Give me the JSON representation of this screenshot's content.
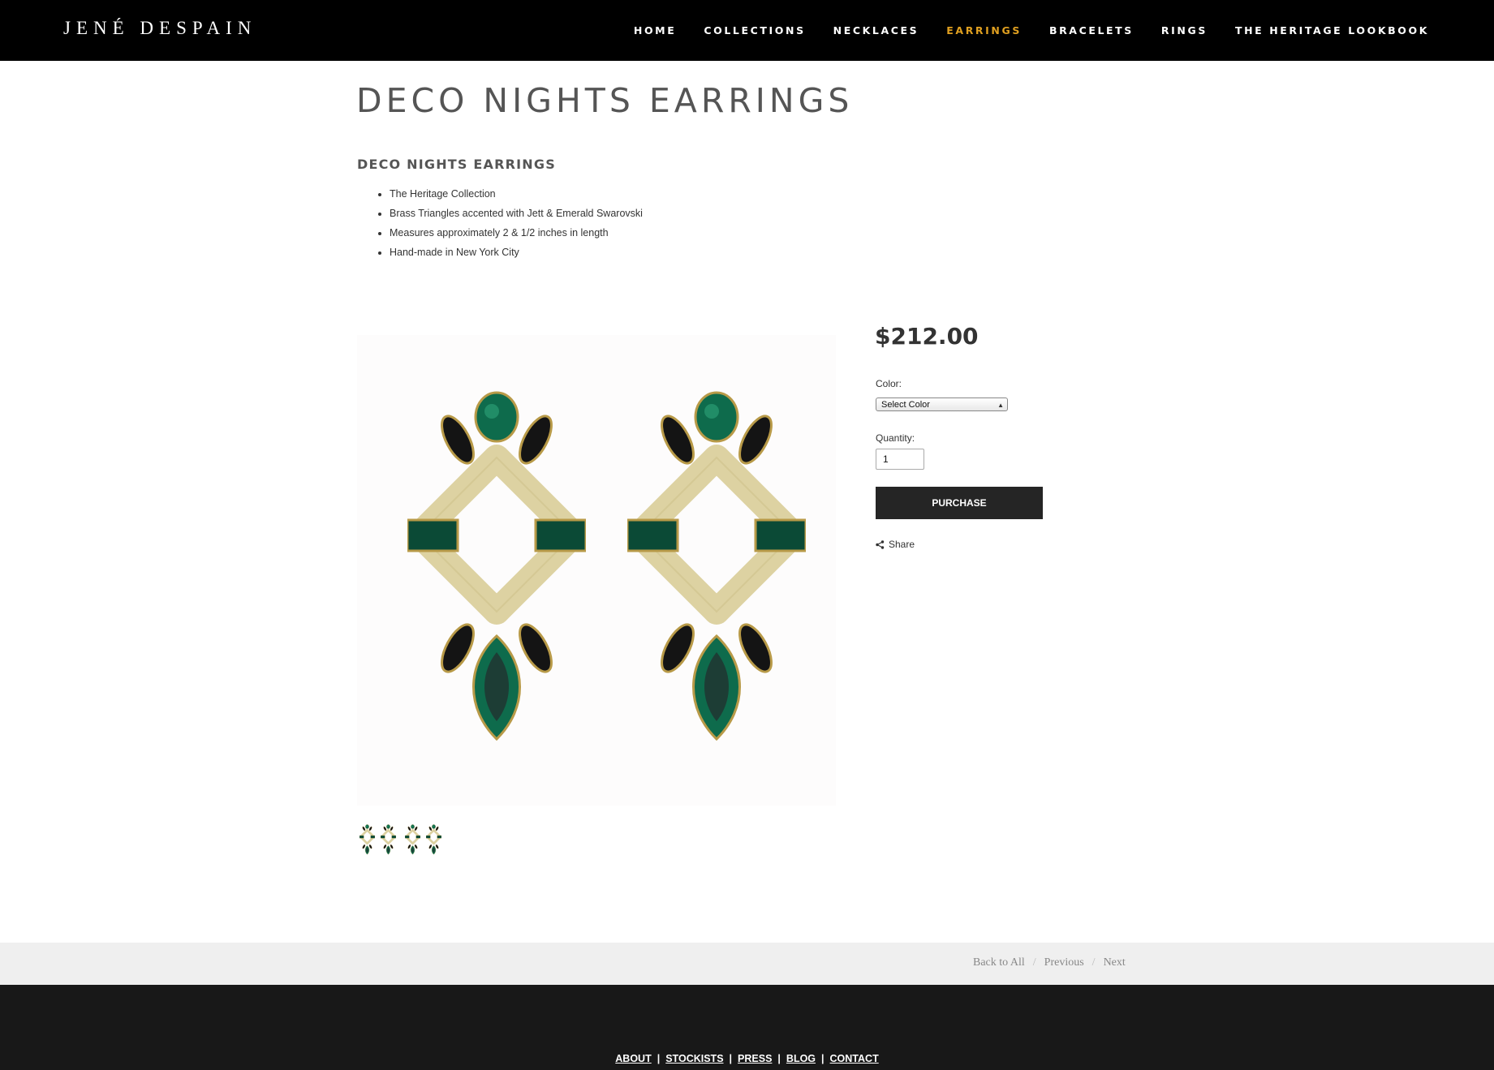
{
  "header": {
    "logo": "JENÉ DESPAIN",
    "nav": [
      "HOME",
      "COLLECTIONS",
      "NECKLACES",
      "EARRINGS",
      "BRACELETS",
      "RINGS",
      "THE HERITAGE LOOKBOOK"
    ],
    "active_item": "EARRINGS",
    "active_color": "#e0a020"
  },
  "product": {
    "page_title": "DECO NIGHTS EARRINGS",
    "subtitle": "DECO NIGHTS EARRINGS",
    "details": [
      "The Heritage Collection",
      "Brass Triangles accented with Jett & Emerald Swarovski",
      "Measures approximately 2 & 1/2 inches in length",
      "Hand-made in New York City"
    ],
    "price": "$212.00",
    "color_label": "Color:",
    "color_select": "Select Color",
    "quantity_label": "Quantity:",
    "quantity_value": "1",
    "purchase_label": "PURCHASE",
    "share_label": "Share"
  },
  "pager": {
    "back": "Back to All",
    "separator": "/",
    "previous": "Previous",
    "next": "Next"
  },
  "footer": {
    "links": [
      "ABOUT",
      "STOCKISTS",
      "PRESS",
      "BLOG",
      "CONTACT"
    ]
  }
}
